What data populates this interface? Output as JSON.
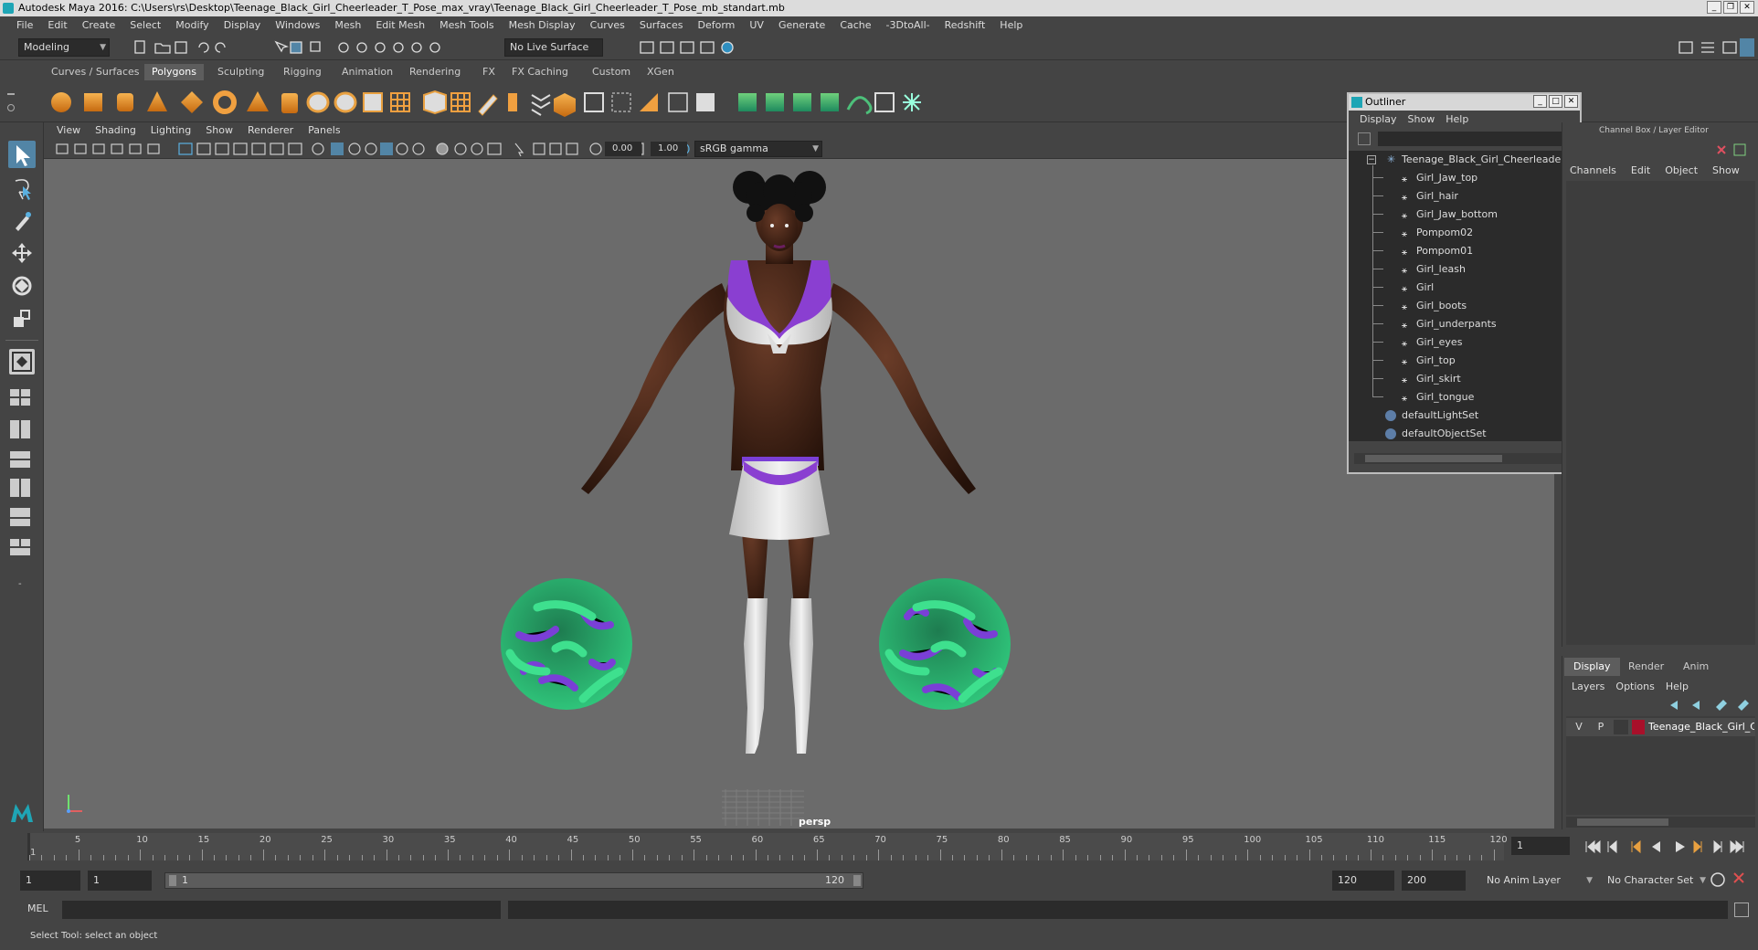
{
  "window": {
    "title": "Autodesk Maya 2016: C:\\Users\\rs\\Desktop\\Teenage_Black_Girl_Cheerleader_T_Pose_max_vray\\Teenage_Black_Girl_Cheerleader_T_Pose_mb_standart.mb"
  },
  "menubar": [
    "File",
    "Edit",
    "Create",
    "Select",
    "Modify",
    "Display",
    "Windows",
    "Mesh",
    "Edit Mesh",
    "Mesh Tools",
    "Mesh Display",
    "Curves",
    "Surfaces",
    "Deform",
    "UV",
    "Generate",
    "Cache",
    "-3DtoAll-",
    "Redshift",
    "Help"
  ],
  "statusline": {
    "mode": "Modeling",
    "live_surface": "No Live Surface"
  },
  "shelf": {
    "tabs": [
      "Curves / Surfaces",
      "Polygons",
      "Sculpting",
      "Rigging",
      "Animation",
      "Rendering",
      "FX",
      "FX Caching",
      "Custom",
      "XGen"
    ],
    "active_tab": "Polygons"
  },
  "viewport": {
    "menu": [
      "View",
      "Shading",
      "Lighting",
      "Show",
      "Renderer",
      "Panels"
    ],
    "exposure": "0.00",
    "gamma": "1.00",
    "color_space": "sRGB gamma",
    "camera_label": "persp",
    "colors": {
      "background": "#6b6b6b",
      "skin": "#3a1f14",
      "outfit": "#e2e2e2",
      "outfit_accent": "#8a3fd1",
      "pompom_green": "#2fc47a",
      "pompom_purple": "#7a3fd6"
    }
  },
  "outliner": {
    "title": "Outliner",
    "menu": [
      "Display",
      "Show",
      "Help"
    ],
    "root": "Teenage_Black_Girl_Cheerleader_",
    "children": [
      "Girl_Jaw_top",
      "Girl_hair",
      "Girl_Jaw_bottom",
      "Pompom02",
      "Pompom01",
      "Girl_leash",
      "Girl",
      "Girl_boots",
      "Girl_underpants",
      "Girl_eyes",
      "Girl_top",
      "Girl_skirt",
      "Girl_tongue"
    ],
    "sets": [
      "defaultLightSet",
      "defaultObjectSet"
    ]
  },
  "channelbox": {
    "title": "Channel Box / Layer Editor",
    "menu": [
      "Channels",
      "Edit",
      "Object",
      "Show"
    ]
  },
  "layers": {
    "tabs": [
      "Display",
      "Render",
      "Anim"
    ],
    "active_tab": "Display",
    "menu": [
      "Layers",
      "Options",
      "Help"
    ],
    "row": {
      "v": "V",
      "p": "P",
      "name": "Teenage_Black_Girl_Ch",
      "color": "#a8102a"
    }
  },
  "timeline": {
    "start_label": "1",
    "ticks": [
      "5",
      "10",
      "15",
      "20",
      "25",
      "30",
      "35",
      "40",
      "45",
      "50",
      "55",
      "60",
      "65",
      "70",
      "75",
      "80",
      "85",
      "90",
      "95",
      "100",
      "105",
      "110",
      "115",
      "120"
    ],
    "current_frame": "1"
  },
  "range": {
    "start": "1",
    "start2": "1",
    "slider_start": "1",
    "slider_end": "120",
    "end": "120",
    "end2": "200",
    "anim_layer": "No Anim Layer",
    "character_set": "No Character Set"
  },
  "command": {
    "label": "MEL"
  },
  "helpline": {
    "text": "Select Tool: select an object"
  }
}
